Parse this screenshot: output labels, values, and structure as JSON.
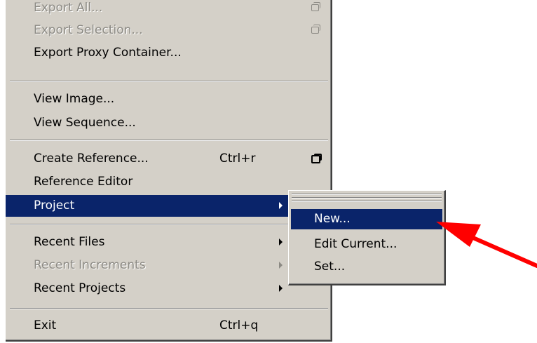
{
  "menu": {
    "items": [
      {
        "label": "Export All...",
        "shortcut": "",
        "state": "disabled",
        "option_box": true
      },
      {
        "label": "Export Selection...",
        "shortcut": "",
        "state": "disabled",
        "option_box": true
      },
      {
        "label": "Export Proxy Container...",
        "shortcut": "",
        "state": "normal"
      },
      {
        "label": "View Image...",
        "shortcut": "",
        "state": "normal"
      },
      {
        "label": "View Sequence...",
        "shortcut": "",
        "state": "normal"
      },
      {
        "label": "Create Reference...",
        "shortcut": "Ctrl+r",
        "state": "normal",
        "option_box": true
      },
      {
        "label": "Reference Editor",
        "shortcut": "",
        "state": "normal"
      },
      {
        "label": "Project",
        "shortcut": "",
        "state": "selected",
        "submenu": true
      },
      {
        "label": "Recent Files",
        "shortcut": "",
        "state": "normal",
        "submenu": true
      },
      {
        "label": "Recent Increments",
        "shortcut": "",
        "state": "disabled",
        "submenu": true
      },
      {
        "label": "Recent Projects",
        "shortcut": "",
        "state": "normal",
        "submenu": true
      },
      {
        "label": "Exit",
        "shortcut": "Ctrl+q",
        "state": "normal"
      }
    ]
  },
  "submenu": {
    "items": [
      {
        "label": "New...",
        "state": "selected"
      },
      {
        "label": "Edit Current...",
        "state": "normal"
      },
      {
        "label": "Set...",
        "state": "normal"
      }
    ]
  },
  "colors": {
    "menu_bg": "#d4d0c8",
    "highlight": "#0a246a",
    "annotation_arrow": "#ff0000"
  }
}
